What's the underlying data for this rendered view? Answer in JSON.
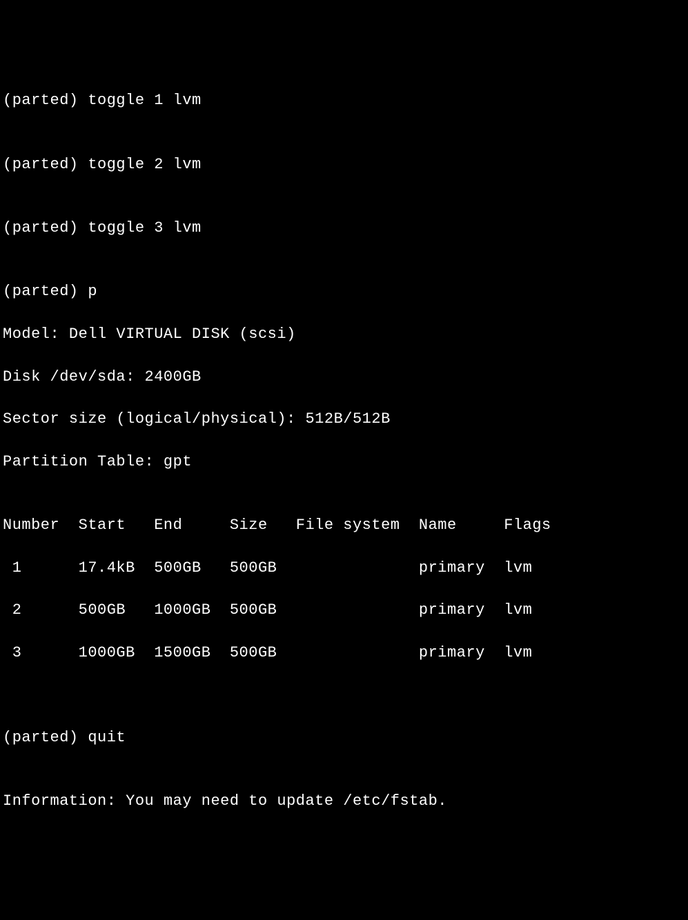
{
  "prompt": "(parted)",
  "commands": {
    "toggle1": "toggle 1 lvm",
    "toggle2": "toggle 2 lvm",
    "toggle3": "toggle 3 lvm",
    "print": "p",
    "quit": "quit"
  },
  "diskInfo": {
    "model": "Model: Dell VIRTUAL DISK (scsi)",
    "disk": "Disk /dev/sda: 2400GB",
    "sectorSize": "Sector size (logical/physical): 512B/512B",
    "partitionTable": "Partition Table: gpt"
  },
  "tableHeader": {
    "number": "Number",
    "start": "Start",
    "end": "End",
    "size": "Size",
    "fileSystem": "File system",
    "name": "Name",
    "flags": "Flags"
  },
  "partitions": [
    {
      "number": "1",
      "start": "17.4kB",
      "end": "500GB",
      "size": "500GB",
      "fileSystem": "",
      "name": "primary",
      "flags": "lvm"
    },
    {
      "number": "2",
      "start": "500GB",
      "end": "1000GB",
      "size": "500GB",
      "fileSystem": "",
      "name": "primary",
      "flags": "lvm"
    },
    {
      "number": "3",
      "start": "1000GB",
      "end": "1500GB",
      "size": "500GB",
      "fileSystem": "",
      "name": "primary",
      "flags": "lvm"
    }
  ],
  "infoMessage": "Information: You may need to update /etc/fstab."
}
